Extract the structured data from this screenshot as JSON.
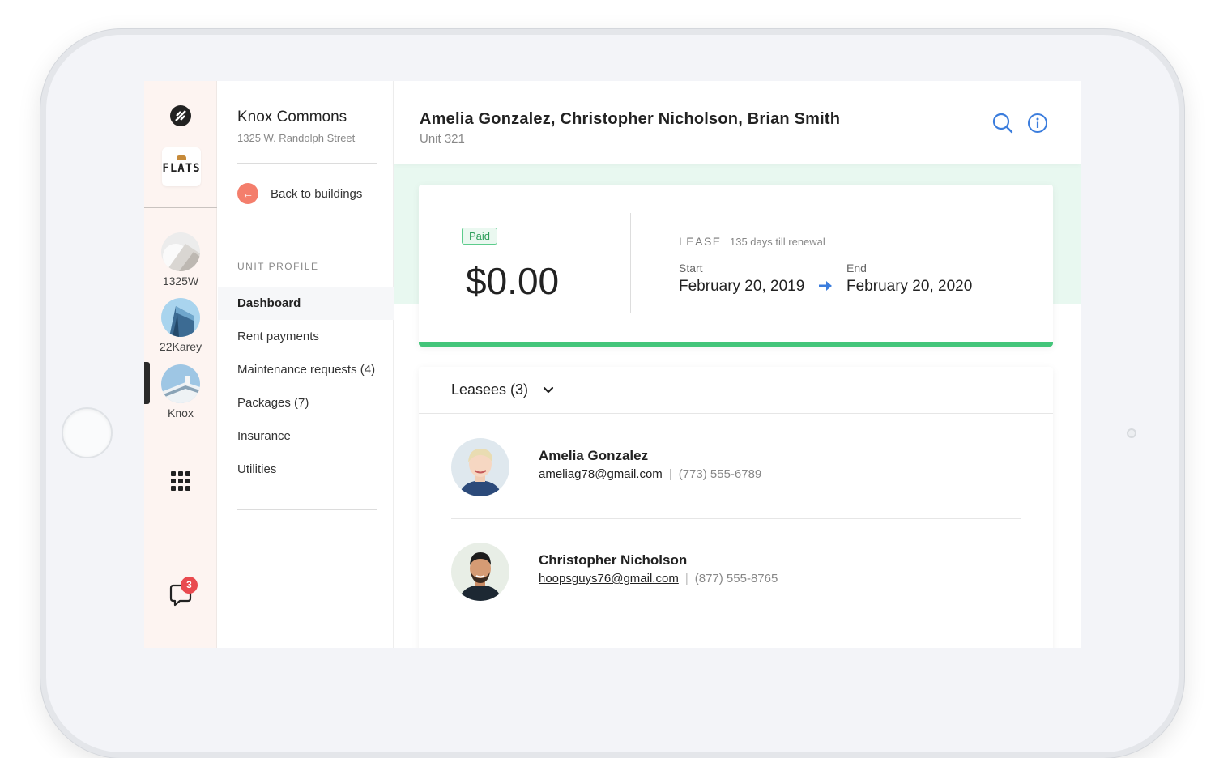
{
  "rail": {
    "logo_icon": "compass-logo-icon",
    "brand_word": "FLATS",
    "buildings": [
      {
        "label": "1325W",
        "icon": "building-photo-1325w"
      },
      {
        "label": "22Karey",
        "icon": "building-photo-22karey"
      },
      {
        "label": "Knox",
        "icon": "building-photo-knox"
      }
    ],
    "apps_icon": "grid-icon",
    "chat_icon": "chat-icon",
    "chat_badge": "3"
  },
  "sidebar": {
    "building_name": "Knox Commons",
    "building_address": "1325 W. Randolph Street",
    "back_label": "Back to buildings",
    "section_label": "UNIT PROFILE",
    "items": [
      {
        "label": "Dashboard",
        "active": true
      },
      {
        "label": "Rent payments",
        "active": false
      },
      {
        "label": "Maintenance requests (4)",
        "active": false
      },
      {
        "label": "Packages (7)",
        "active": false
      },
      {
        "label": "Insurance",
        "active": false
      },
      {
        "label": "Utilities",
        "active": false
      }
    ]
  },
  "header": {
    "title": "Amelia Gonzalez, Christopher Nicholson, Brian Smith",
    "subtitle": "Unit 321",
    "icons": [
      "search-icon",
      "info-icon"
    ]
  },
  "summary": {
    "status": "Paid",
    "amount": "$0.00",
    "lease_label": "LEASE",
    "lease_note": "135 days till renewal",
    "start_label": "Start",
    "start_date": "February 20, 2019",
    "end_label": "End",
    "end_date": "February 20, 2020"
  },
  "leasees": {
    "title": "Leasees (3)",
    "people": [
      {
        "name": "Amelia Gonzalez",
        "email": "ameliag78@gmail.com",
        "phone": "(773) 555-6789"
      },
      {
        "name": "Christopher Nicholson",
        "email": "hoopsguys76@gmail.com",
        "phone": "(877) 555-8765"
      }
    ]
  },
  "colors": {
    "accent_blue": "#3b7ddd",
    "paid_green": "#43c57a",
    "back_coral": "#f47e6c",
    "badge_red": "#e94a4f",
    "mint_bg": "#e8f8f0"
  }
}
